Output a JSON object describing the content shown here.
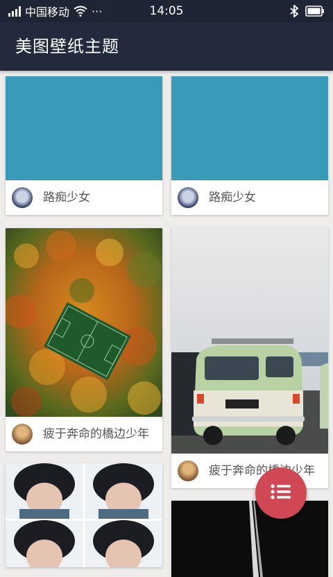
{
  "status_bar": {
    "carrier": "中国移动",
    "more": "···",
    "time": "14:05"
  },
  "app_bar": {
    "title": "美图壁纸主题"
  },
  "cards": [
    {
      "author": "路痴少女",
      "image": "solid teal placeholder",
      "color": "#3a9bb8"
    },
    {
      "author": "路痴少女",
      "image": "solid teal placeholder",
      "color": "#3a9bb8"
    },
    {
      "author": "疲于奔命的橋边少年",
      "image": "aerial autumn forest with soccer field"
    },
    {
      "author": "疲于奔命的橋边少年",
      "image": "green vintage van by the sea"
    },
    {
      "author": "",
      "image": "portrait grid of young man"
    },
    {
      "author": "",
      "image": "dark night road"
    }
  ],
  "fab": {
    "icon": "list-icon"
  },
  "colors": {
    "accent": "#d04854",
    "app_bar": "#232a3e",
    "background": "#eeedeb"
  }
}
